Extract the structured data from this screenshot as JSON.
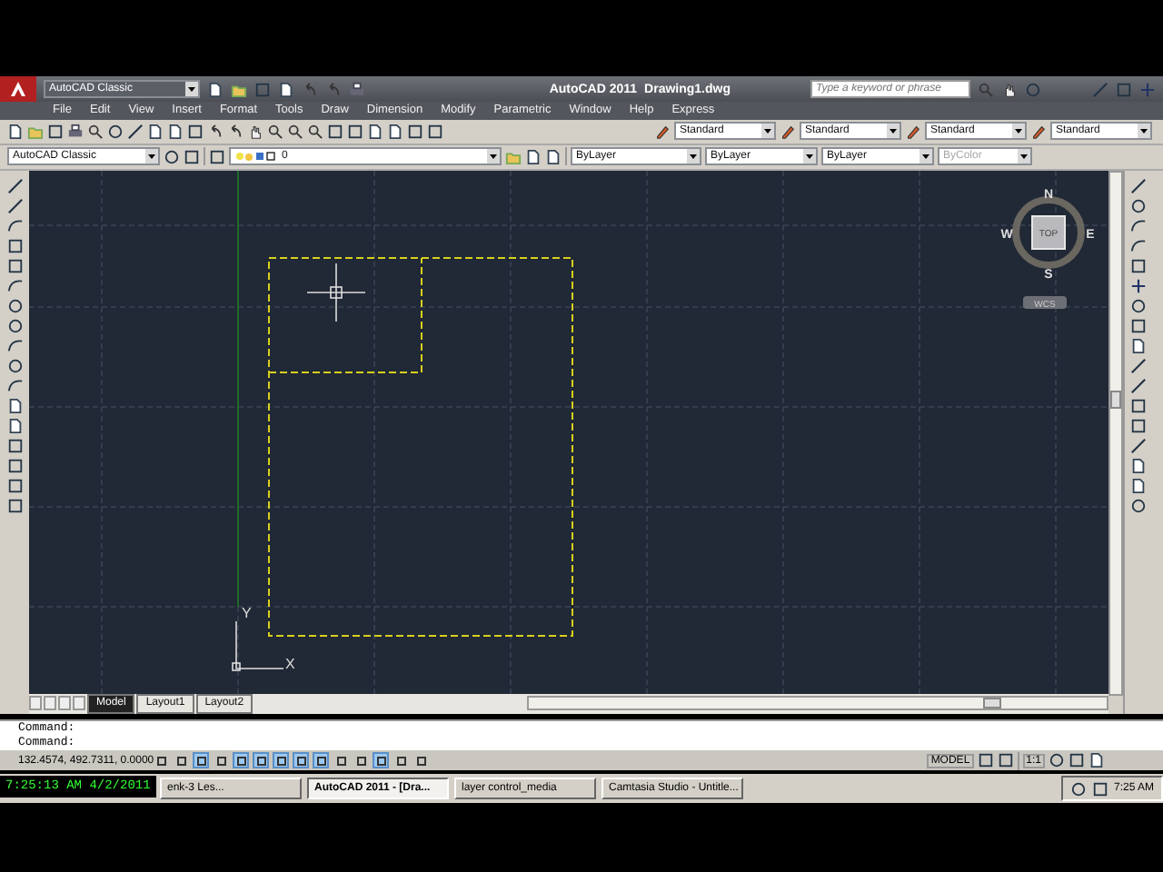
{
  "title_bar": {
    "workspace": "AutoCAD Classic",
    "app": "AutoCAD 2011",
    "document": "Drawing1.dwg",
    "search": {
      "placeholder": "Type a keyword or phrase"
    }
  },
  "menu": [
    "File",
    "Edit",
    "View",
    "Insert",
    "Format",
    "Tools",
    "Draw",
    "Dimension",
    "Modify",
    "Parametric",
    "Window",
    "Help",
    "Express"
  ],
  "styles": [
    "Standard",
    "Standard",
    "Standard",
    "Standard"
  ],
  "workspace_dropdown": "AutoCAD Classic",
  "layer": "0",
  "properties": [
    {
      "value": "ByLayer",
      "disabled": false
    },
    {
      "value": "ByLayer",
      "disabled": false
    },
    {
      "value": "ByLayer",
      "disabled": false
    },
    {
      "value": "ByColor",
      "disabled": true
    }
  ],
  "viewcube": {
    "north": "N",
    "south": "S",
    "east": "E",
    "west": "W",
    "face": "TOP",
    "ucs": "WCS"
  },
  "ucs_icon": {
    "x": "X",
    "y": "Y"
  },
  "layout_tabs": [
    {
      "label": "Model",
      "selected": true
    },
    {
      "label": "Layout1",
      "selected": false
    },
    {
      "label": "Layout2",
      "selected": false
    }
  ],
  "command_lines": [
    "Command:",
    "Command:"
  ],
  "status": {
    "coordinates": "132.4574, 492.7311, 0.0000",
    "toggles": [
      {
        "on": false
      },
      {
        "on": false
      },
      {
        "on": true
      },
      {
        "on": false
      },
      {
        "on": true
      },
      {
        "on": true
      },
      {
        "on": true
      },
      {
        "on": true
      },
      {
        "on": true
      },
      {
        "on": false
      },
      {
        "on": false
      },
      {
        "on": true
      },
      {
        "on": false
      },
      {
        "on": false
      }
    ],
    "space": "MODEL",
    "scale": "1:1"
  },
  "clock_overlay": "7:25:13 AM 4/2/2011",
  "taskbar": {
    "tasks": [
      {
        "label": "enk-3 Les...",
        "selected": false
      },
      {
        "label": "AutoCAD 2011 - [Dra...",
        "selected": true
      },
      {
        "label": "layer control_media",
        "selected": false
      },
      {
        "label": "Camtasia Studio - Untitle...",
        "selected": false
      }
    ],
    "time": "7:25 AM"
  }
}
